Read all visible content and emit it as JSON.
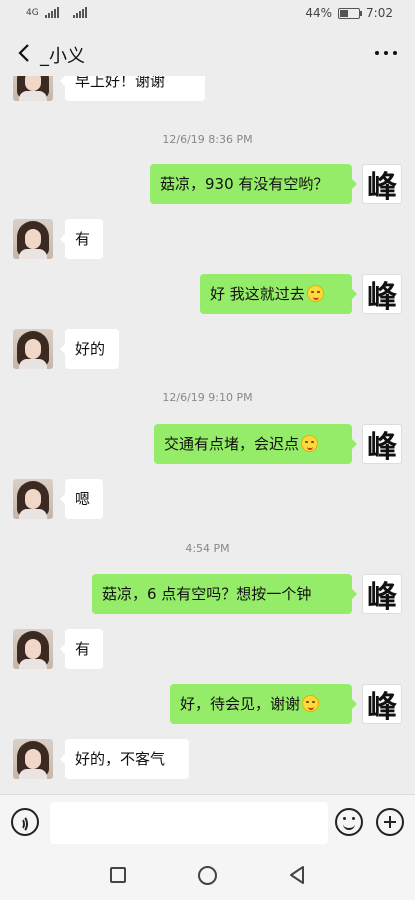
{
  "status_bar": {
    "network": "4G",
    "battery_text": "44%",
    "battery_level": 0.44,
    "time": "7:02"
  },
  "header": {
    "title": "_小义",
    "back_icon": "chevron-left-icon",
    "more_icon": "more-dots-icon"
  },
  "contact_avatar_char": "峰",
  "messages": [
    {
      "id": "m0",
      "side": "left",
      "text": "早上好！谢谢",
      "emoji": false
    },
    {
      "id": "t1",
      "type": "timestamp",
      "text": "12/6/19 8:36 PM"
    },
    {
      "id": "m1",
      "side": "right",
      "text": "菇凉，930 有没有空哟？",
      "emoji": false
    },
    {
      "id": "m2",
      "side": "left",
      "text": "有",
      "emoji": false
    },
    {
      "id": "m3",
      "side": "right",
      "text": "好 我这就过去",
      "emoji": true
    },
    {
      "id": "m4",
      "side": "left",
      "text": "好的",
      "emoji": false
    },
    {
      "id": "t2",
      "type": "timestamp",
      "text": "12/6/19 9:10 PM"
    },
    {
      "id": "m5",
      "side": "right",
      "text": "交通有点堵，会迟点",
      "emoji": true
    },
    {
      "id": "m6",
      "side": "left",
      "text": "嗯",
      "emoji": false
    },
    {
      "id": "t3",
      "type": "timestamp",
      "text": "4:54 PM"
    },
    {
      "id": "m7",
      "side": "right",
      "text": "菇凉，6 点有空吗？想按一个钟",
      "emoji": false
    },
    {
      "id": "m8",
      "side": "left",
      "text": "有",
      "emoji": false
    },
    {
      "id": "m9",
      "side": "right",
      "text": "好，待会见，谢谢",
      "emoji": true
    },
    {
      "id": "m10",
      "side": "left",
      "text": "好的，不客气",
      "emoji": false
    }
  ],
  "input_bar": {
    "text_value": "",
    "voice_icon": "voice-icon",
    "emoji_icon": "emoji-icon",
    "add_icon": "plus-icon"
  },
  "nav_bar": {
    "recent_icon": "square-icon",
    "home_icon": "circle-icon",
    "back_icon": "triangle-back-icon"
  },
  "colors": {
    "sent_bubble": "#95ec69",
    "received_bubble": "#ffffff",
    "chat_background": "#ededed"
  }
}
